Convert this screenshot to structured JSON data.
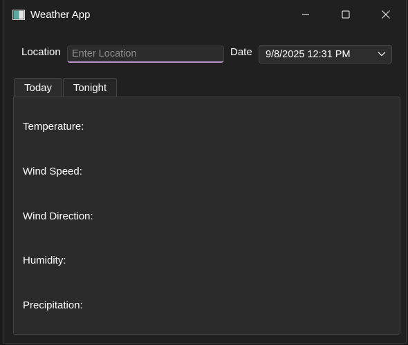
{
  "window": {
    "title": "Weather App",
    "icon": "app-window-icon",
    "controls": [
      "minimize-icon",
      "maximize-icon",
      "close-icon"
    ]
  },
  "form": {
    "location_label": "Location",
    "location_placeholder": "Enter Location",
    "location_value": "",
    "date_label": "Date",
    "date_value": "9/8/2025 12:31 PM"
  },
  "tabs": [
    {
      "label": "Today",
      "selected": true
    },
    {
      "label": "Tonight",
      "selected": false
    }
  ],
  "fields": [
    {
      "label": "Temperature:"
    },
    {
      "label": "Wind Speed:"
    },
    {
      "label": "Wind Direction:"
    },
    {
      "label": "Humidity:"
    },
    {
      "label": "Precipitation:"
    }
  ],
  "colors": {
    "background": "#202020",
    "panel": "#2b2b2b",
    "input_accent": "#b894c9"
  }
}
